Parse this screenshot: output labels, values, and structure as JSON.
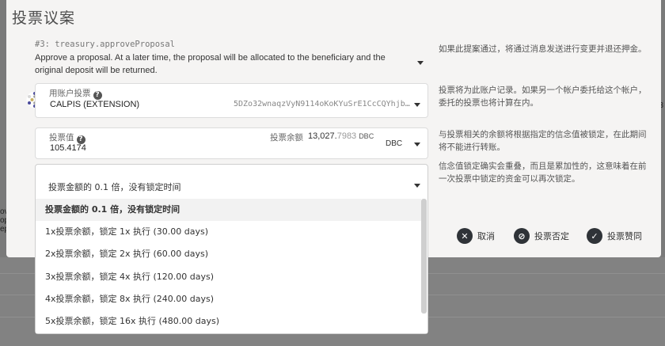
{
  "modal": {
    "title": "投票议案"
  },
  "proposal": {
    "call": "#3: treasury.approveProposal",
    "description": "Approve a proposal. At a later time, the proposal will be allocated to the beneficiary and the original deposit will be returned.",
    "hint": "如果此提案通过，将通过消息发送进行变更并退还押金。"
  },
  "account": {
    "label": "用账户投票",
    "name": "CALPIS (EXTENSION)",
    "address": "5DZo32wnaqzVyN9114oKoKYuSrE1CcCQYhjb5...",
    "hint": "投票将为此账户记录。如果另一个帐户委托给这个帐户，委托的投票也将计算在内。"
  },
  "vote_value": {
    "label": "投票值",
    "value": "105.4174",
    "balance_label": "投票余额",
    "balance_int": "13,027.",
    "balance_dec": "7983",
    "balance_unit": "DBC",
    "unit": "DBC",
    "hint": "与投票相关的余额将根据指定的信念值被锁定，在此期间将不能进行转账。"
  },
  "conviction": {
    "current": "投票金额的 0.1 倍，没有锁定时间",
    "hint": "信念值锁定确实会重叠，而且是累加性的，这意味着在前一次投票中锁定的资金可以再次锁定。",
    "options": [
      "投票金额的 0.1 倍，没有锁定时间",
      "1x投票余额，锁定 1x 执行 (30.00 days)",
      "2x投票余额，锁定 2x 执行 (60.00 days)",
      "3x投票余额，锁定 4x 执行 (120.00 days)",
      "4x投票余额，锁定 8x 执行 (240.00 days)",
      "5x投票余额，锁定 16x 执行 (480.00 days)"
    ]
  },
  "actions": {
    "cancel": "取消",
    "nay": "投票否定",
    "aye": "投票赞同"
  },
  "background": {
    "left_fragments": [
      "ov",
      "op",
      "ep"
    ],
    "right_fragment": "13"
  }
}
